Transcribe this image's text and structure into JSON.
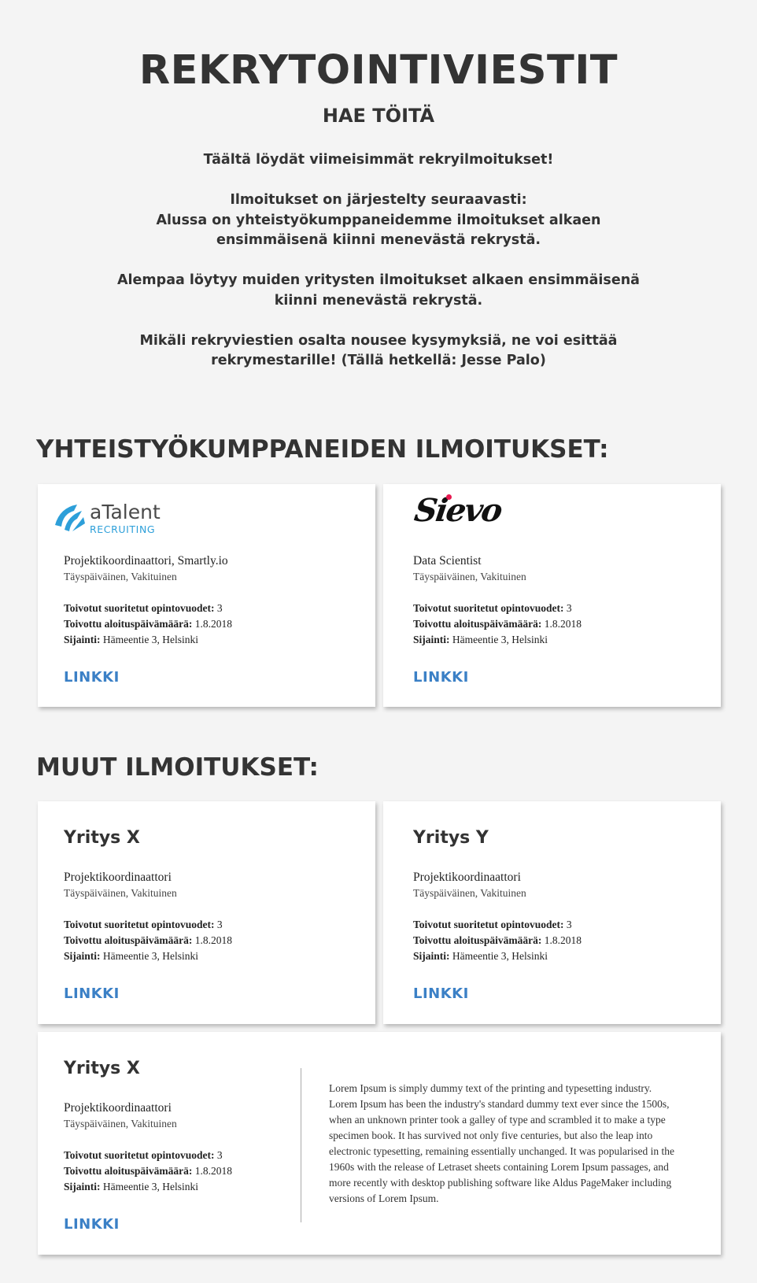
{
  "header": {
    "title": "REKRYTOINTIVIESTIT",
    "subtitle": "HAE TÖITÄ"
  },
  "intro": {
    "p1": "Täältä löydät viimeisimmät rekryilmoitukset!",
    "p2_line1": "Ilmoitukset on järjestelty seuraavasti:",
    "p2_line2": "Alussa on yhteistyökumppaneidemme ilmoitukset alkaen ensimmäisenä kiinni menevästä rekrystä.",
    "p3": "Alempaa löytyy muiden yritysten ilmoitukset alkaen ensimmäisenä kiinni menevästä rekrystä.",
    "p4": "Mikäli rekryviestien osalta nousee kysymyksiä, ne voi esittää rekrymestarille! (Tällä hetkellä: Jesse Palo)"
  },
  "partners": {
    "heading": "YHTEISTYÖKUMPPANEIDEN ILMOITUKSET:",
    "cards": [
      {
        "logo_word": "aTalent",
        "logo_sub": "RECRUITING",
        "title": "Projektikoordinaattori, Smartly.io",
        "type": "Täyspäiväinen, Vakituinen",
        "credits_label": "Toivotut suoritetut opintovuodet:",
        "credits_value": "3",
        "start_label": "Toivottu aloituspäivämäärä:",
        "start_value": "1.8.2018",
        "location_label": "Sijainti:",
        "location_value": "Hämeentie 3, Helsinki",
        "link": "LINKKI"
      },
      {
        "logo_word": "Sievo",
        "title": "Data Scientist",
        "type": "Täyspäiväinen, Vakituinen",
        "credits_label": "Toivotut suoritetut opintovuodet:",
        "credits_value": "3",
        "start_label": "Toivottu aloituspäivämäärä:",
        "start_value": "1.8.2018",
        "location_label": "Sijainti:",
        "location_value": "Hämeentie 3, Helsinki",
        "link": "LINKKI"
      }
    ]
  },
  "others": {
    "heading": "MUUT ILMOITUKSET:",
    "cards": [
      {
        "company": "Yritys X",
        "title": "Projektikoordinaattori",
        "type": "Täyspäiväinen, Vakituinen",
        "credits_label": "Toivotut suoritetut opintovuodet:",
        "credits_value": "3",
        "start_label": "Toivottu aloituspäivämäärä:",
        "start_value": "1.8.2018",
        "location_label": "Sijainti:",
        "location_value": "Hämeentie 3, Helsinki",
        "link": "LINKKI"
      },
      {
        "company": "Yritys Y",
        "title": "Projektikoordinaattori",
        "type": "Täyspäiväinen, Vakituinen",
        "credits_label": "Toivotut suoritetut opintovuodet:",
        "credits_value": "3",
        "start_label": "Toivottu aloituspäivämäärä:",
        "start_value": "1.8.2018",
        "location_label": "Sijainti:",
        "location_value": "Hämeentie 3, Helsinki",
        "link": "LINKKI"
      },
      {
        "company": "Yritys X",
        "title": "Projektikoordinaattori",
        "type": "Täyspäiväinen, Vakituinen",
        "credits_label": "Toivotut suoritetut opintovuodet:",
        "credits_value": "3",
        "start_label": "Toivottu aloituspäivämäärä:",
        "start_value": "1.8.2018",
        "location_label": "Sijainti:",
        "location_value": "Hämeentie 3, Helsinki",
        "link": "LINKKI",
        "description": "Lorem Ipsum is simply dummy text of the printing and typesetting industry. Lorem Ipsum has been the industry's standard dummy text ever since the 1500s, when an unknown printer took a galley of type and scrambled it to make a type specimen book. It has survived not only five centuries, but also the leap into electronic typesetting, remaining essentially unchanged. It was popularised in the 1960s with the release of Letraset sheets containing Lorem Ipsum passages, and more recently with desktop publishing software like Aldus PageMaker including versions of Lorem Ipsum."
      }
    ]
  },
  "colors": {
    "background": "#f4f4f4",
    "heading": "#333333",
    "link": "#3b80c6",
    "atalent_blue": "#2d9fd9",
    "sievo_dot": "#e8174f"
  }
}
